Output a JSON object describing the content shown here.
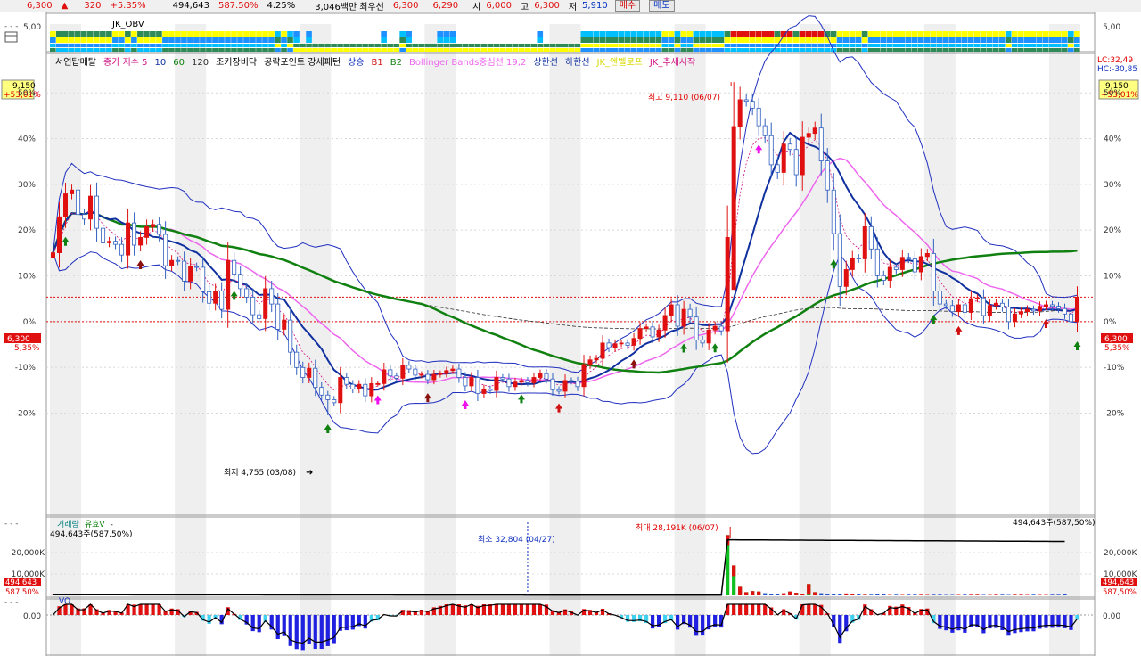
{
  "header": {
    "price": "6,300",
    "change_arrow": "▲",
    "change": "320",
    "change_pct": "+5.35%",
    "volume": "494,643",
    "vol_ratio": "587.50%",
    "turnover": "4.25%",
    "amount": "3,046백만",
    "label_prio": "최우선",
    "bid1": "6,300",
    "bid2": "6,290",
    "open_label": "시",
    "open": "6,000",
    "high_label": "고",
    "high": "6,300",
    "low_label": "저",
    "low": "5,910",
    "buy_btn": "매수",
    "sell_btn": "매도"
  },
  "obv_panel": {
    "title": "JK_OBV",
    "axis_label": "5,00"
  },
  "main_panel": {
    "legend": [
      {
        "text": "서연탑메탈",
        "color": "#000000"
      },
      {
        "text": "종가 지수 5",
        "color": "#d01080"
      },
      {
        "text": "10",
        "color": "#1030a0"
      },
      {
        "text": "60",
        "color": "#108010"
      },
      {
        "text": "120",
        "color": "#303030"
      },
      {
        "text": "조커장비닥",
        "color": "#000000"
      },
      {
        "text": "공략포인트 강세패턴",
        "color": "#000000"
      },
      {
        "text": "상승",
        "color": "#1030c0"
      },
      {
        "text": "B1",
        "color": "#d01010"
      },
      {
        "text": "B2",
        "color": "#108010"
      },
      {
        "text": "Bollinger Bands중심선 19,2",
        "color": "#ee66ee"
      },
      {
        "text": "상한선",
        "color": "#1030a0"
      },
      {
        "text": "하한선",
        "color": "#1030a0"
      },
      {
        "text": "JK_엔벨로프",
        "color": "#d8d800"
      },
      {
        "text": "JK_추세시작",
        "color": "#d01080"
      }
    ],
    "lc": "LC:32,49",
    "hc": "HC:-30,85",
    "box_price": "9,150",
    "box_pct": "+53,01%",
    "cur_price": "6,300",
    "cur_pct": "5,35%",
    "high_label": "최고 9,110 (06/07)",
    "low_label": "최저 4,755 (03/08)"
  },
  "volume_panel": {
    "legend": [
      {
        "text": "거래량",
        "color": "#008080"
      },
      {
        "text": "유효V",
        "color": "#108010"
      },
      {
        "text": "-",
        "color": "#000000"
      }
    ],
    "value_text": "494,643주(587,50%)",
    "right_value_text": "494,643주(587,50%)",
    "tag_value": "494,643",
    "tag_pct": "587,50%",
    "min_label": "최소 32,804 (04/27)",
    "max_label": "최대 28,191K (06/07)"
  },
  "vo_panel": {
    "title": "VO",
    "axis_label": "0,00"
  },
  "chart_data": {
    "type": "bar",
    "title": "서연탑메탈",
    "y_axis_pct_ticks": [
      "50%",
      "40%",
      "30%",
      "20%",
      "10%",
      "0%",
      "-10%",
      "-20%"
    ],
    "volume_ticks": [
      "20,000K",
      "10,000K"
    ],
    "price_range": [
      3450,
      9450
    ],
    "base_price": 5980,
    "volume_ylim": [
      0,
      30000
    ],
    "high": 9110,
    "low": 4755,
    "candles_close": [
      6880,
      7350,
      7650,
      7700,
      7380,
      7320,
      7620,
      7200,
      7010,
      7030,
      6990,
      6850,
      7270,
      6980,
      7080,
      7220,
      7250,
      7120,
      6710,
      6780,
      6770,
      6510,
      6700,
      6690,
      6370,
      6220,
      6380,
      6140,
      6780,
      6600,
      6410,
      6300,
      6070,
      6020,
      6410,
      6210,
      5880,
      6000,
      5580,
      5380,
      5250,
      5370,
      5120,
      5020,
      4960,
      4920,
      5250,
      5160,
      5100,
      5160,
      5010,
      5170,
      5170,
      5350,
      5270,
      5240,
      5410,
      5360,
      5280,
      5290,
      5220,
      5290,
      5300,
      5340,
      5360,
      5250,
      5140,
      5250,
      5040,
      5100,
      5080,
      5250,
      5230,
      5130,
      5190,
      5210,
      5180,
      5250,
      5300,
      5230,
      5090,
      5070,
      5210,
      5200,
      5130,
      5420,
      5480,
      5500,
      5700,
      5640,
      5690,
      5700,
      5670,
      5760,
      5890,
      5910,
      5780,
      5870,
      6060,
      6200,
      5920,
      6140,
      6040,
      5740,
      5700,
      5870,
      5920,
      5860,
      7080,
      8530,
      8880,
      8860,
      8770,
      8540,
      8410,
      8030,
      7930,
      8300,
      8230,
      7900,
      8390,
      8440,
      8510,
      8080,
      7700,
      7130,
      6440,
      6660,
      6810,
      6800,
      7220,
      6930,
      6580,
      6520,
      6690,
      6660,
      6820,
      6800,
      6630,
      6830,
      6870,
      6380,
      6210,
      6190,
      6110,
      6200,
      6100,
      6280,
      6290,
      6060,
      6190,
      6220,
      6170,
      5980,
      6080,
      6110,
      6140,
      6120,
      6180,
      6200,
      6180,
      6150,
      6080,
      5980,
      6300
    ],
    "volume_k": [
      90,
      450,
      80,
      60,
      50,
      40,
      35,
      30,
      30,
      25,
      25,
      20,
      20,
      20,
      18,
      18,
      18,
      16,
      16,
      15,
      15,
      15,
      14,
      14,
      14,
      14,
      14,
      13,
      13,
      13,
      12,
      12,
      12,
      12,
      12,
      12,
      11,
      11,
      11,
      11,
      10,
      10,
      10,
      10,
      10,
      10,
      10,
      10,
      10,
      10,
      9,
      9,
      9,
      9,
      9,
      9,
      9,
      9,
      9,
      8,
      8,
      8,
      8,
      8,
      8,
      8,
      8,
      8,
      8,
      8,
      8,
      8,
      8,
      8,
      8,
      8,
      33,
      8,
      8,
      8,
      8,
      8,
      8,
      9,
      9,
      9,
      10,
      10,
      12,
      20,
      30,
      40,
      50,
      80,
      120,
      150,
      300,
      500,
      800,
      200,
      150,
      120,
      400,
      200,
      150,
      300,
      200,
      150,
      28191,
      14000,
      4000,
      1500,
      2000,
      1800,
      1000,
      500,
      600,
      1000,
      1800,
      1200,
      800,
      5300,
      1500,
      1000,
      800,
      500,
      600,
      900,
      700,
      400,
      300,
      300,
      500,
      400,
      200,
      300,
      200,
      300,
      300,
      300,
      200,
      300,
      300,
      200,
      200,
      200,
      300,
      300,
      300,
      200,
      200,
      300,
      300,
      200,
      300,
      300,
      200,
      300,
      200,
      200,
      300,
      300,
      494
    ]
  }
}
